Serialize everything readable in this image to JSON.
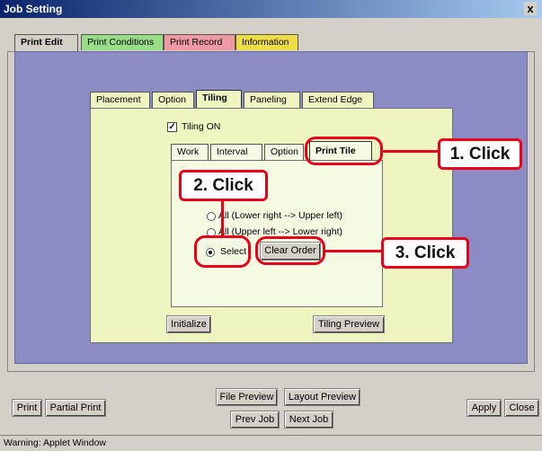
{
  "window": {
    "title": "Job Setting",
    "close_glyph": "x"
  },
  "top_tabs": [
    {
      "label": "Print Edit",
      "color": "#d4d0c8"
    },
    {
      "label": "Print Conditions",
      "color": "#99dd88"
    },
    {
      "label": "Print Record",
      "color": "#ee9aa0"
    },
    {
      "label": "Information",
      "color": "#eedd44"
    }
  ],
  "inner_tabs": [
    "Placement",
    "Option",
    "Tiling",
    "Paneling",
    "Extend Edge"
  ],
  "tiling_on": {
    "label": "Tiling ON",
    "checked": true
  },
  "sub_tabs": [
    "Work",
    "Interval",
    "Option",
    "Print Tile"
  ],
  "radios": [
    {
      "label": "All (Lower right --> Upper left)",
      "selected": false
    },
    {
      "label": "All (Upper left --> Lower right)",
      "selected": false
    },
    {
      "label": "Select",
      "selected": true
    }
  ],
  "buttons": {
    "clear_order": "Clear Order",
    "initialize": "Initialize",
    "tiling_preview": "Tiling Preview",
    "print": "Print",
    "partial_print": "Partial Print",
    "file_preview": "File Preview",
    "layout_preview": "Layout Preview",
    "prev_job": "Prev Job",
    "next_job": "Next Job",
    "apply": "Apply",
    "close": "Close"
  },
  "callouts": {
    "step1": "1. Click",
    "step2": "2. Click",
    "step3": "3. Click"
  },
  "status": "Warning: Applet Window",
  "colors": {
    "outer_panel": "#8c8cc4",
    "inner_panel": "#eef5c0",
    "sub_panel": "#f4fbe2",
    "accent_red": "#e8001c"
  }
}
